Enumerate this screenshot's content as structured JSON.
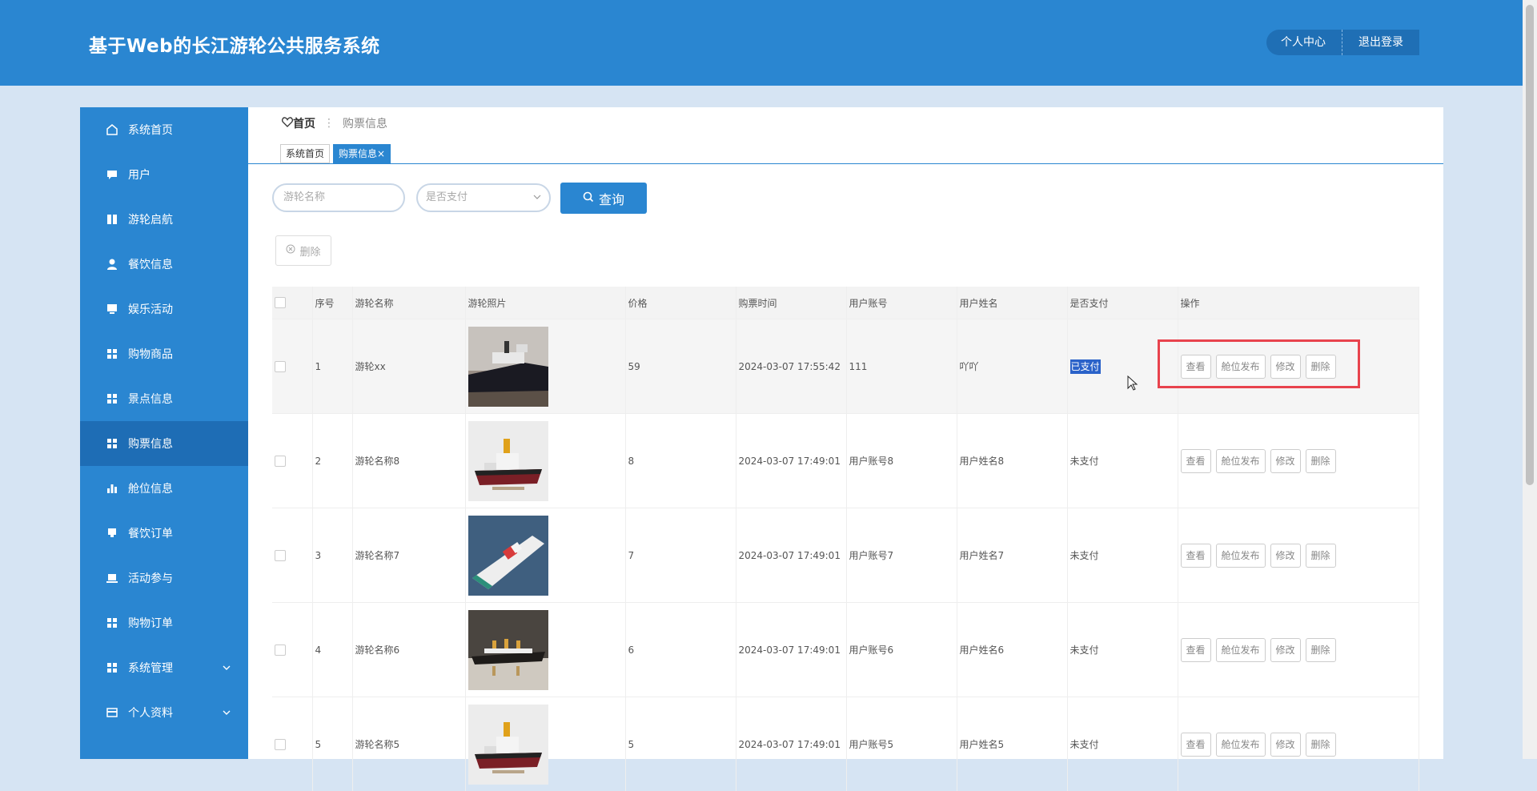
{
  "header": {
    "title": "基于Web的长江游轮公共服务系统",
    "personal_center": "个人中心",
    "logout": "退出登录"
  },
  "sidebar": {
    "items": [
      {
        "label": "系统首页",
        "icon": "home-icon"
      },
      {
        "label": "用户",
        "icon": "chat-icon"
      },
      {
        "label": "游轮启航",
        "icon": "book-icon"
      },
      {
        "label": "餐饮信息",
        "icon": "user-icon"
      },
      {
        "label": "娱乐活动",
        "icon": "monitor-icon"
      },
      {
        "label": "购物商品",
        "icon": "grid-icon"
      },
      {
        "label": "景点信息",
        "icon": "grid-icon"
      },
      {
        "label": "购票信息",
        "icon": "grid-icon",
        "active": true
      },
      {
        "label": "舱位信息",
        "icon": "bar-chart-icon"
      },
      {
        "label": "餐饮订单",
        "icon": "cup-icon"
      },
      {
        "label": "活动参与",
        "icon": "laptop-icon"
      },
      {
        "label": "购物订单",
        "icon": "grid-icon"
      },
      {
        "label": "系统管理",
        "icon": "grid-icon",
        "expandable": true
      },
      {
        "label": "个人资料",
        "icon": "card-icon",
        "expandable": true
      }
    ]
  },
  "breadcrumb": {
    "home": "首页",
    "current": "购票信息"
  },
  "tabs": [
    {
      "label": "系统首页"
    },
    {
      "label": "购票信息",
      "close": "×",
      "active": true
    }
  ],
  "search": {
    "name_placeholder": "游轮名称",
    "paid_placeholder": "是否支付",
    "query_label": "查询"
  },
  "toolbar": {
    "delete_label": "删除"
  },
  "table": {
    "headers": [
      "序号",
      "游轮名称",
      "游轮照片",
      "价格",
      "购票时间",
      "用户账号",
      "用户姓名",
      "是否支付",
      "操作"
    ],
    "rows": [
      {
        "index": "1",
        "name": "游轮xx",
        "price": "59",
        "time": "2024-03-07 17:55:42",
        "account": "111",
        "username": "吖吖",
        "paid": "已支付",
        "photo": "ship-photo-1"
      },
      {
        "index": "2",
        "name": "游轮名称8",
        "price": "8",
        "time": "2024-03-07 17:49:01",
        "account": "用户账号8",
        "username": "用户姓名8",
        "paid": "未支付",
        "photo": "tugboat-model-photo"
      },
      {
        "index": "3",
        "name": "游轮名称7",
        "price": "7",
        "time": "2024-03-07 17:49:01",
        "account": "用户账号7",
        "username": "用户姓名7",
        "paid": "未支付",
        "photo": "coastguard-model-photo"
      },
      {
        "index": "4",
        "name": "游轮名称6",
        "price": "6",
        "time": "2024-03-07 17:49:01",
        "account": "用户账号6",
        "username": "用户姓名6",
        "paid": "未支付",
        "photo": "liner-model-photo"
      },
      {
        "index": "5",
        "name": "游轮名称5",
        "price": "5",
        "time": "2024-03-07 17:49:01",
        "account": "用户账号5",
        "username": "用户姓名5",
        "paid": "未支付",
        "photo": "tugboat-model-photo"
      }
    ],
    "actions": {
      "view": "查看",
      "publish": "舱位发布",
      "edit": "修改",
      "delete": "删除"
    }
  },
  "colors": {
    "primary": "#2a86d1",
    "sidebar_active": "#1e6db5",
    "highlight_box": "#e8434d"
  }
}
